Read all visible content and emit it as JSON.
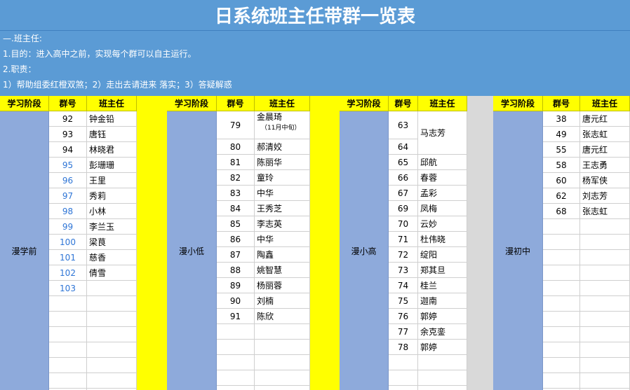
{
  "title": "日系统班主任带群一览表",
  "intro": {
    "heading": "—.班主任:",
    "purpose": "1.目的：进入高中之前，实现每个群可以自主运行。",
    "duty_label": "2.职责：",
    "duties": "1）帮助组委红橙双煞；2）走出去请进来 落实；3）答疑解惑"
  },
  "headers": {
    "stage": "学习阶段",
    "group": "群号",
    "teacher": "班主任"
  },
  "sections": [
    {
      "stage": "漫学前",
      "rows": [
        {
          "num": "92",
          "name": "钟金铅",
          "blue": false
        },
        {
          "num": "93",
          "name": "唐钰",
          "blue": false
        },
        {
          "num": "94",
          "name": "林晓君",
          "blue": false
        },
        {
          "num": "95",
          "name": "彭珊珊",
          "blue": true
        },
        {
          "num": "96",
          "name": "王里",
          "blue": true
        },
        {
          "num": "97",
          "name": "秀莉",
          "blue": true
        },
        {
          "num": "98",
          "name": "小林",
          "blue": true
        },
        {
          "num": "99",
          "name": "李兰玉",
          "blue": true
        },
        {
          "num": "100",
          "name": "梁茛",
          "blue": true
        },
        {
          "num": "101",
          "name": "慈香",
          "blue": true
        },
        {
          "num": "102",
          "name": "倩雪",
          "blue": true
        },
        {
          "num": "103",
          "name": "",
          "blue": true
        }
      ]
    },
    {
      "stage": "漫小低",
      "rows": [
        {
          "num": "79",
          "name": "金晨琦",
          "note": "（11月中旬）",
          "blue": false
        },
        {
          "num": "80",
          "name": "郝清姣",
          "blue": false
        },
        {
          "num": "81",
          "name": "陈丽华",
          "blue": false
        },
        {
          "num": "82",
          "name": "童玲",
          "blue": false
        },
        {
          "num": "83",
          "name": "中华",
          "blue": false
        },
        {
          "num": "84",
          "name": "王秀芝",
          "blue": false
        },
        {
          "num": "85",
          "name": "李志英",
          "blue": false
        },
        {
          "num": "86",
          "name": "中华",
          "blue": false
        },
        {
          "num": "87",
          "name": "陶鑫",
          "blue": false
        },
        {
          "num": "88",
          "name": "姚智慧",
          "blue": false
        },
        {
          "num": "89",
          "name": "杨丽蓉",
          "blue": false
        },
        {
          "num": "90",
          "name": "刘楠",
          "blue": false
        },
        {
          "num": "91",
          "name": "陈欣",
          "blue": false
        }
      ]
    },
    {
      "stage": "漫小高",
      "rows": [
        {
          "num": "63",
          "name": "马志芳",
          "blue": false
        },
        {
          "num": "64",
          "name": "",
          "blue": false
        },
        {
          "num": "65",
          "name": "邱航",
          "blue": false
        },
        {
          "num": "66",
          "name": "春蓉",
          "blue": false
        },
        {
          "num": "67",
          "name": "孟彩",
          "blue": false
        },
        {
          "num": "69",
          "name": "凤梅",
          "blue": false
        },
        {
          "num": "70",
          "name": "云妙",
          "blue": false
        },
        {
          "num": "71",
          "name": "杜伟晓",
          "blue": false
        },
        {
          "num": "72",
          "name": "绽阳",
          "blue": false
        },
        {
          "num": "73",
          "name": "郑其旦",
          "blue": false
        },
        {
          "num": "74",
          "name": "桂兰",
          "blue": false
        },
        {
          "num": "75",
          "name": "迦南",
          "blue": false
        },
        {
          "num": "76",
          "name": "郭婷",
          "blue": false
        },
        {
          "num": "77",
          "name": "余克銮",
          "blue": false
        },
        {
          "num": "78",
          "name": "郭婷",
          "blue": false
        }
      ]
    },
    {
      "stage": "漫初中",
      "rows": [
        {
          "num": "38",
          "name": "唐元红",
          "blue": false
        },
        {
          "num": "49",
          "name": "张志虹",
          "blue": false
        },
        {
          "num": "55",
          "name": "唐元红",
          "blue": false
        },
        {
          "num": "58",
          "name": "王志勇",
          "blue": false
        },
        {
          "num": "60",
          "name": "杨军侠",
          "blue": false
        },
        {
          "num": "62",
          "name": "刘志芳",
          "blue": false
        },
        {
          "num": "68",
          "name": "张志虹",
          "blue": false
        }
      ]
    }
  ]
}
